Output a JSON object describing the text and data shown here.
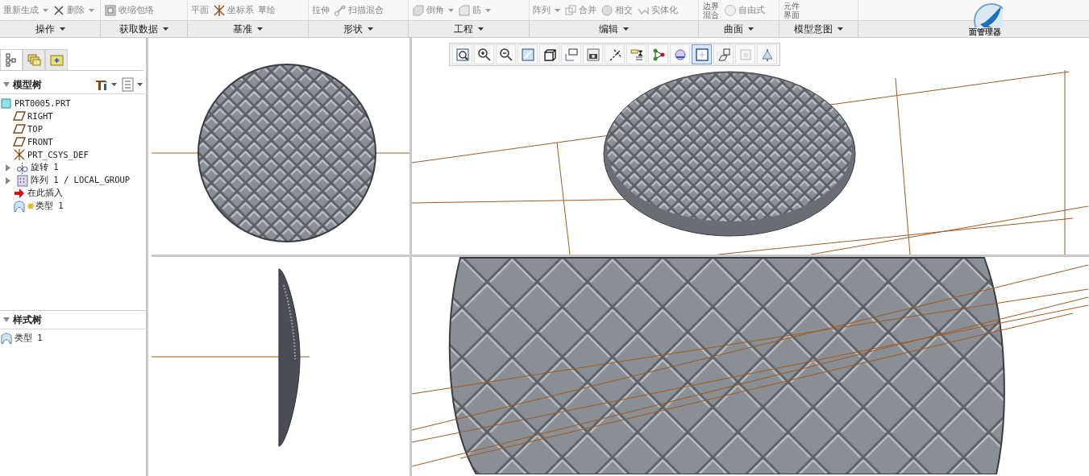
{
  "ribbon": {
    "groups": [
      {
        "label": "操作",
        "commands": [
          {
            "label": "重新生成",
            "kind": "regen",
            "dropdown": true
          },
          {
            "label": "删除",
            "kind": "delete",
            "dropdown": true
          }
        ]
      },
      {
        "label": "获取数据",
        "commands": [
          {
            "label": "收缩包络",
            "kind": "shrink",
            "dropdown": false
          }
        ]
      },
      {
        "label": "基准",
        "commands": [
          {
            "label": "平面",
            "kind": "plain",
            "dropdown": false
          },
          {
            "label": "坐标系",
            "kind": "csys",
            "dropdown": false
          },
          {
            "label": "草绘",
            "kind": "plain",
            "dropdown": false
          }
        ]
      },
      {
        "label": "形状",
        "commands": [
          {
            "label": "拉伸",
            "kind": "plain",
            "dropdown": false
          },
          {
            "label": "扫描混合",
            "kind": "sweep",
            "dropdown": false
          }
        ]
      },
      {
        "label": "工程",
        "commands": [
          {
            "label": "倒角",
            "kind": "chamfer",
            "dropdown": true
          },
          {
            "label": "筋",
            "kind": "rib",
            "dropdown": true
          }
        ]
      },
      {
        "label": "编辑",
        "commands": [
          {
            "label": "阵列",
            "kind": "plain",
            "dropdown": true
          },
          {
            "label": "合并",
            "kind": "merge",
            "dropdown": false
          },
          {
            "label": "相交",
            "kind": "intersect",
            "dropdown": false
          },
          {
            "label": "实体化",
            "kind": "solidify",
            "dropdown": false
          }
        ]
      },
      {
        "label": "曲面",
        "commands": [
          {
            "label": "边界混合",
            "kind": "plain",
            "dropdown": false
          },
          {
            "label": "自由式",
            "kind": "freestyle",
            "dropdown": false
          }
        ]
      },
      {
        "label": "模型意图",
        "commands": [
          {
            "label": "元件界面",
            "kind": "plain",
            "dropdown": false
          }
        ]
      }
    ]
  },
  "logo": {
    "label": "面管理器"
  },
  "panel_tabs": [
    {
      "kind": "tree",
      "selected": true
    },
    {
      "kind": "folders",
      "selected": false
    },
    {
      "kind": "favorites",
      "selected": false
    }
  ],
  "model_tree": {
    "title": "模型树",
    "items": [
      {
        "label": "PRT0005.PRT",
        "kind": "part",
        "children": [
          {
            "label": "RIGHT",
            "kind": "plane"
          },
          {
            "label": "TOP",
            "kind": "plane"
          },
          {
            "label": "FRONT",
            "kind": "plane"
          },
          {
            "label": "PRT_CSYS_DEF",
            "kind": "csys"
          },
          {
            "label": "旋转 1",
            "kind": "revolve",
            "expanded": false
          },
          {
            "label": "阵列 1 / LOCAL_GROUP",
            "kind": "pattern",
            "expanded": false
          },
          {
            "label": "在此插入",
            "kind": "insert"
          },
          {
            "label": "类型 1",
            "kind": "style"
          }
        ]
      }
    ]
  },
  "style_tree": {
    "title": "样式树",
    "items": [
      {
        "label": "类型 1",
        "kind": "style"
      }
    ]
  },
  "view_toolbar": [
    {
      "kind": "refit",
      "selected": false
    },
    {
      "kind": "zoom_in",
      "selected": false
    },
    {
      "kind": "zoom_out",
      "selected": false
    },
    {
      "kind": "repaint",
      "selected": false
    },
    {
      "kind": "display",
      "selected": false
    },
    {
      "kind": "views",
      "selected": false
    },
    {
      "kind": "camera",
      "selected": false
    },
    {
      "kind": "datum",
      "selected": false
    },
    {
      "kind": "annotation",
      "selected": false
    },
    {
      "kind": "nodes",
      "selected": false
    },
    {
      "kind": "appearance",
      "selected": false
    },
    {
      "kind": "split",
      "selected": true
    },
    {
      "kind": "orient",
      "selected": false
    },
    {
      "kind": "layers",
      "selected": false
    },
    {
      "kind": "section",
      "selected": false
    }
  ],
  "viewports": [
    {
      "kind": "front"
    },
    {
      "kind": "iso"
    },
    {
      "kind": "side"
    },
    {
      "kind": "zoom"
    }
  ]
}
